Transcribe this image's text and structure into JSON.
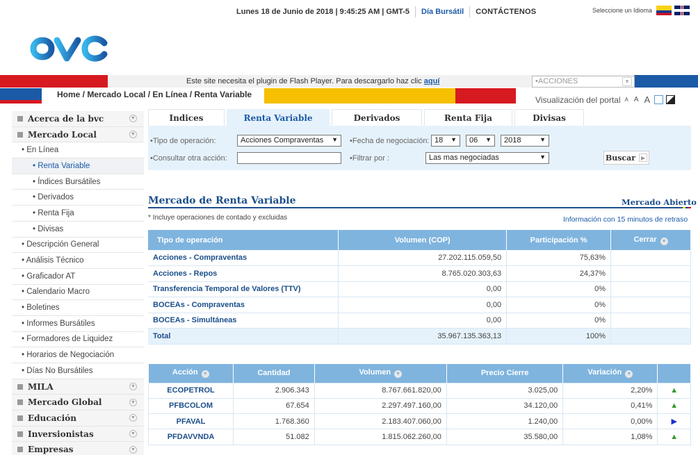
{
  "topbar": {
    "datetime": "Lunes 18 de Junio de 2018 | 9:45:25 AM | GMT-5",
    "day_status": "Día Bursátil",
    "contact": "CONTÁCTENOS",
    "language_label": "Seleccione un Idioma"
  },
  "logo": {
    "text": "bvc"
  },
  "flash_notice": {
    "text": "Este site necesita el plugin de Flash Player. Para descargarlo haz clic ",
    "link": "aquí"
  },
  "market_select": {
    "value": "•ACCIONES"
  },
  "breadcrumb": "Home / Mercado Local / En Línea / Renta Variable",
  "portal_view": {
    "label": "Visualización del portal",
    "a_small": "A",
    "a_medium": "A",
    "a_large": "A"
  },
  "sidebar": {
    "items": [
      {
        "label": "Acerca de la bvc",
        "type": "main"
      },
      {
        "label": "Mercado Local",
        "type": "main"
      },
      {
        "label": "• En Línea",
        "type": "sub"
      },
      {
        "label": "•  Renta Variable",
        "type": "sub2",
        "active": true
      },
      {
        "label": "•  Índices Bursátiles",
        "type": "sub2"
      },
      {
        "label": "•  Derivados",
        "type": "sub2"
      },
      {
        "label": "•  Renta Fija",
        "type": "sub2"
      },
      {
        "label": "•  Divisas",
        "type": "sub2"
      },
      {
        "label": "• Descripción General",
        "type": "sub"
      },
      {
        "label": "• Análisis Técnico",
        "type": "sub"
      },
      {
        "label": "• Graficador AT",
        "type": "sub"
      },
      {
        "label": "• Calendario Macro",
        "type": "sub"
      },
      {
        "label": "• Boletines",
        "type": "sub"
      },
      {
        "label": "• Informes Bursátiles",
        "type": "sub"
      },
      {
        "label": "• Formadores de Liquidez",
        "type": "sub"
      },
      {
        "label": "• Horarios de Negociación",
        "type": "sub"
      },
      {
        "label": "• Días No Bursátiles",
        "type": "sub"
      },
      {
        "label": "MILA",
        "type": "main"
      },
      {
        "label": "Mercado Global",
        "type": "main"
      },
      {
        "label": "Educación",
        "type": "main"
      },
      {
        "label": "Inversionistas",
        "type": "main"
      },
      {
        "label": "Empresas",
        "type": "main"
      }
    ]
  },
  "tabs": [
    {
      "label": "Indices",
      "active": false
    },
    {
      "label": "Renta Variable",
      "active": true
    },
    {
      "label": "Derivados",
      "active": false
    },
    {
      "label": "Renta Fija",
      "active": false
    },
    {
      "label": "Divisas",
      "active": false
    }
  ],
  "filters": {
    "operation_label": "•Tipo de operación:",
    "operation_value": "Acciones Compraventas",
    "date_label": "•Fecha de negociación:",
    "day": "18",
    "month": "06",
    "year": "2018",
    "other_label": "•Consultar otra acción:",
    "other_value": "",
    "filter_label": "•Filtrar por :",
    "filter_value": "Las mas negociadas",
    "search_button": "Buscar"
  },
  "market": {
    "title": "Mercado de Renta Variable",
    "status": "Mercado Abierto",
    "note": "* Incluye operaciones de contado y excluidas",
    "delay": "Información con 15 minutos de retraso"
  },
  "summary_table": {
    "headers": [
      "Tipo de operación",
      "Volumen (COP)",
      "Participación %",
      "Cerrar"
    ],
    "rows": [
      [
        "Acciones - Compraventas",
        "27.202.115.059,50",
        "75,63%"
      ],
      [
        "Acciones - Repos",
        "8.765.020.303,63",
        "24,37%"
      ],
      [
        "Transferencia Temporal de Valores (TTV)",
        "0,00",
        "0%"
      ],
      [
        "BOCEAs - Compraventas",
        "0,00",
        "0%"
      ],
      [
        "BOCEAs - Simultáneas",
        "0,00",
        "0%"
      ],
      [
        "Total",
        "35.967.135.363,13",
        "100%"
      ]
    ]
  },
  "stocks_table": {
    "headers": [
      "Acción",
      "Cantidad",
      "Volumen",
      "Precio Cierre",
      "Variación"
    ],
    "rows": [
      {
        "symbol": "ECOPETROL",
        "qty": "2.906.343",
        "volume": "8.767.661.820,00",
        "price": "3.025,00",
        "change": "2,20%",
        "trend": "up",
        "icon": "up-triangle-icon"
      },
      {
        "symbol": "PFBCOLOM",
        "qty": "67.654",
        "volume": "2.297.497.160,00",
        "price": "34.120,00",
        "change": "0,41%",
        "trend": "up",
        "icon": "up-triangle-icon"
      },
      {
        "symbol": "PFAVAL",
        "qty": "1.768.360",
        "volume": "2.183.407.060,00",
        "price": "1.240,00",
        "change": "0,00%",
        "trend": "flat",
        "icon": "right-triangle-icon"
      },
      {
        "symbol": "PFDAVVNDA",
        "qty": "51.082",
        "volume": "1.815.062.260,00",
        "price": "35.580,00",
        "change": "1,08%",
        "trend": "up",
        "icon": "up-triangle-icon"
      }
    ]
  },
  "colors": {
    "brand_blue": "#1b5aa6",
    "brand_red": "#d71920",
    "brand_yellow": "#f6c000",
    "table_header": "#7fb4de",
    "up": "#2e9a2e",
    "flat": "#1a33d6"
  }
}
